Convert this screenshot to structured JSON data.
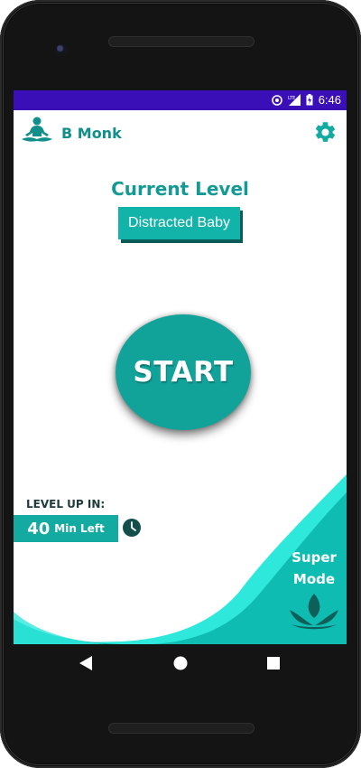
{
  "status_bar": {
    "time": "6:46",
    "icons": [
      "sync-icon",
      "lte-signal-icon",
      "battery-icon"
    ]
  },
  "app": {
    "name": "B Monk"
  },
  "level": {
    "title": "Current Level",
    "current": "Distracted Baby"
  },
  "start": {
    "label": "START"
  },
  "level_up": {
    "label": "LEVEL UP IN:",
    "minutes": "40",
    "unit": "Min Left"
  },
  "super_mode": {
    "label_line1": "Super",
    "label_line2": "Mode"
  },
  "colors": {
    "primary": "#13aaa1",
    "text_teal": "#139a93",
    "status_bar": "#3b0fb8",
    "wave_light": "#2ee8dc"
  }
}
